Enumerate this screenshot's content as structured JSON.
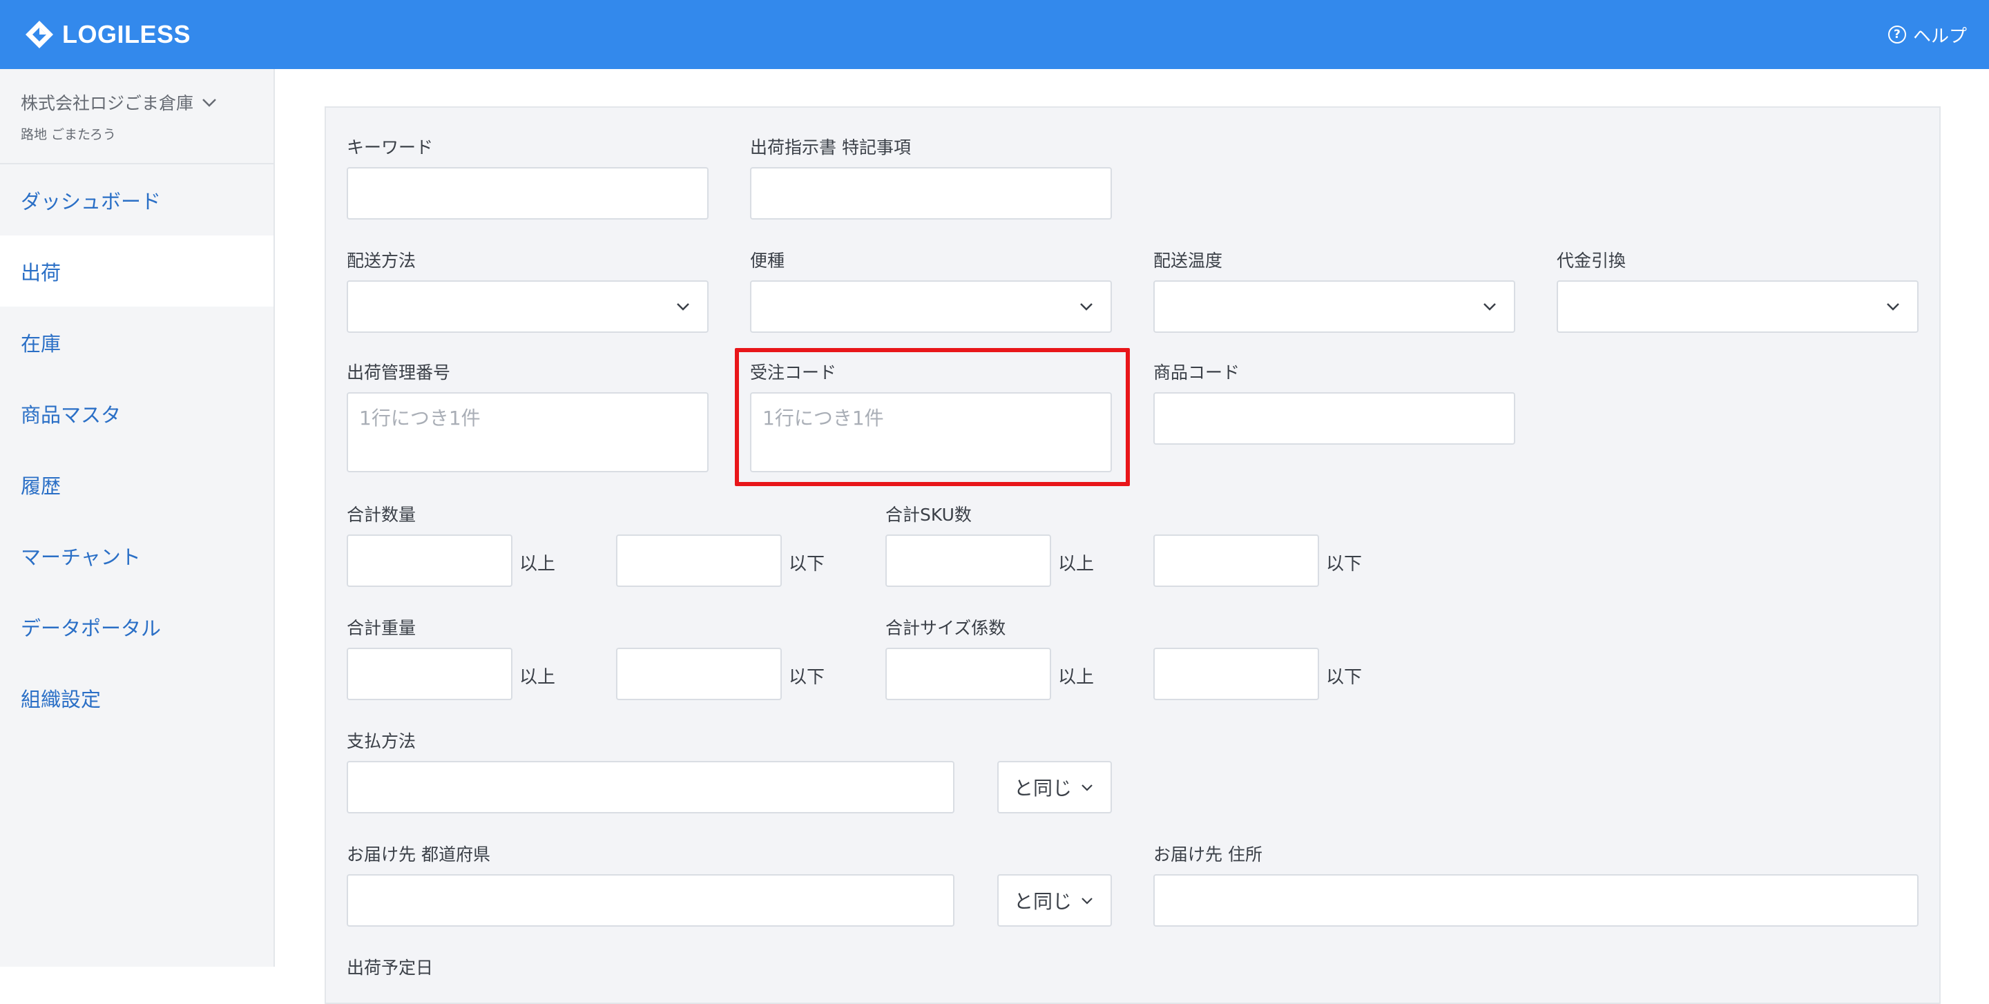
{
  "header": {
    "logo_text": "LOGILESS",
    "help_label": "ヘルプ",
    "help_icon": "?"
  },
  "sidebar": {
    "org_name": "株式会社ロジごま倉庫",
    "user_name": "路地 ごまたろう",
    "items": [
      {
        "label": "ダッシュボード"
      },
      {
        "label": "出荷"
      },
      {
        "label": "在庫"
      },
      {
        "label": "商品マスタ"
      },
      {
        "label": "履歴"
      },
      {
        "label": "マーチャント"
      },
      {
        "label": "データポータル"
      },
      {
        "label": "組織設定"
      }
    ],
    "active_item": "出荷"
  },
  "form": {
    "keyword": {
      "label": "キーワード",
      "value": ""
    },
    "special_notes": {
      "label": "出荷指示書 特記事項",
      "value": ""
    },
    "delivery_method": {
      "label": "配送方法",
      "value": ""
    },
    "service_type": {
      "label": "便種",
      "value": ""
    },
    "delivery_temp": {
      "label": "配送温度",
      "value": ""
    },
    "cod": {
      "label": "代金引換",
      "value": ""
    },
    "shipment_number": {
      "label": "出荷管理番号",
      "placeholder": "1行につき1件"
    },
    "order_code": {
      "label": "受注コード",
      "placeholder": "1行につき1件"
    },
    "product_code": {
      "label": "商品コード",
      "value": ""
    },
    "total_qty": {
      "label": "合計数量",
      "min_unit": "以上",
      "max_unit": "以下"
    },
    "total_sku": {
      "label": "合計SKU数",
      "min_unit": "以上",
      "max_unit": "以下"
    },
    "total_weight": {
      "label": "合計重量",
      "min_unit": "以上",
      "max_unit": "以下"
    },
    "total_size": {
      "label": "合計サイズ係数",
      "min_unit": "以上",
      "max_unit": "以下"
    },
    "payment_method": {
      "label": "支払方法",
      "match_label": "と同じ"
    },
    "prefecture": {
      "label": "お届け先 都道府県",
      "match_label": "と同じ"
    },
    "address": {
      "label": "お届け先 住所",
      "value": ""
    },
    "ship_date": {
      "label": "出荷予定日"
    }
  },
  "highlight_color": "#e8161a",
  "accent_color": "#3389ec"
}
